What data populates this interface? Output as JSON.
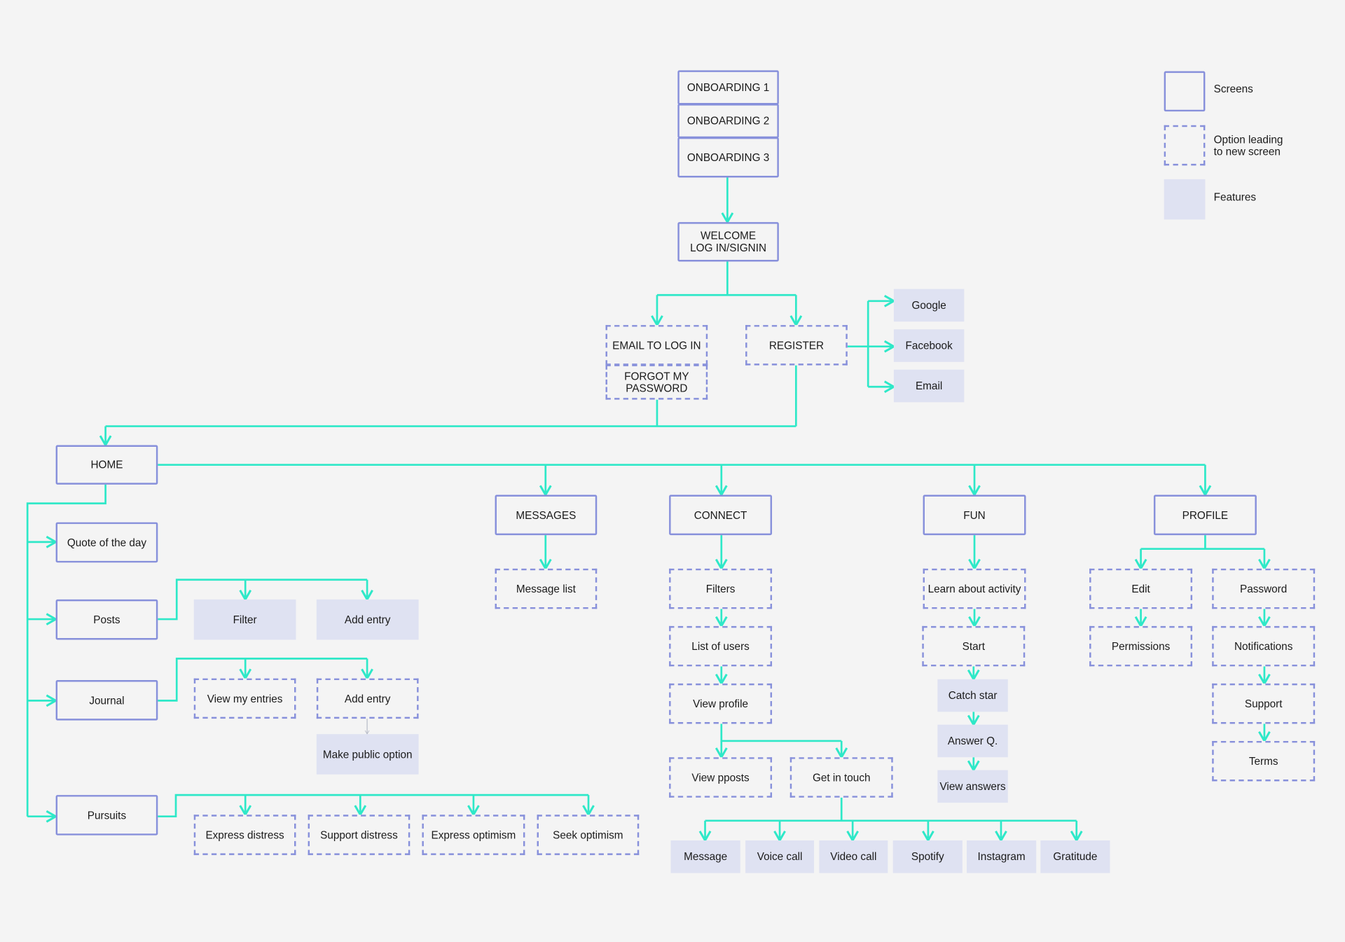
{
  "colors": {
    "background": "#f4f4f4",
    "border": "#8790db",
    "feature_fill": "#dfe2f2",
    "connector": "#2ee8c8"
  },
  "legend": [
    {
      "kind": "screen",
      "label": "Screens"
    },
    {
      "kind": "option",
      "label": "Option leading\nto new screen"
    },
    {
      "kind": "feature",
      "label": "Features"
    }
  ],
  "nodes": [
    {
      "id": "ob1",
      "kind": "screen",
      "label": "ONBOARDING 1"
    },
    {
      "id": "ob2",
      "kind": "screen",
      "label": "ONBOARDING 2"
    },
    {
      "id": "ob3",
      "kind": "screen",
      "label": "ONBOARDING 3"
    },
    {
      "id": "welcome",
      "kind": "screen",
      "label": "WELCOME\nLOG IN/SIGNIN"
    },
    {
      "id": "emaillogin",
      "kind": "option",
      "label": "EMAIL TO LOG IN"
    },
    {
      "id": "forgot",
      "kind": "option",
      "label": "FORGOT MY\nPASSWORD"
    },
    {
      "id": "register",
      "kind": "option",
      "label": "REGISTER"
    },
    {
      "id": "google",
      "kind": "feature",
      "label": "Google"
    },
    {
      "id": "facebook",
      "kind": "feature",
      "label": "Facebook"
    },
    {
      "id": "email",
      "kind": "feature",
      "label": "Email"
    },
    {
      "id": "home",
      "kind": "screen",
      "label": "HOME"
    },
    {
      "id": "messages",
      "kind": "screen",
      "label": "MESSAGES"
    },
    {
      "id": "connect",
      "kind": "screen",
      "label": "CONNECT"
    },
    {
      "id": "fun",
      "kind": "screen",
      "label": "FUN"
    },
    {
      "id": "profile",
      "kind": "screen",
      "label": "PROFILE"
    },
    {
      "id": "quote",
      "kind": "screen",
      "label": "Quote of the day"
    },
    {
      "id": "posts",
      "kind": "screen",
      "label": "Posts"
    },
    {
      "id": "journal",
      "kind": "screen",
      "label": "Journal"
    },
    {
      "id": "pursuits",
      "kind": "screen",
      "label": "Pursuits"
    },
    {
      "id": "filter",
      "kind": "feature",
      "label": "Filter"
    },
    {
      "id": "postadd",
      "kind": "feature",
      "label": "Add entry"
    },
    {
      "id": "viewentries",
      "kind": "option",
      "label": "View my entries"
    },
    {
      "id": "journaladd",
      "kind": "option",
      "label": "Add entry"
    },
    {
      "id": "makepublic",
      "kind": "feature",
      "label": "Make public option"
    },
    {
      "id": "exdistress",
      "kind": "option",
      "label": "Express distress"
    },
    {
      "id": "supdistress",
      "kind": "option",
      "label": "Support distress"
    },
    {
      "id": "exoptimism",
      "kind": "option",
      "label": "Express optimism"
    },
    {
      "id": "seekoptimism",
      "kind": "option",
      "label": "Seek optimism"
    },
    {
      "id": "messagelist",
      "kind": "option",
      "label": "Message list"
    },
    {
      "id": "filters",
      "kind": "option",
      "label": "Filters"
    },
    {
      "id": "listusers",
      "kind": "option",
      "label": "List of users"
    },
    {
      "id": "viewprofile",
      "kind": "option",
      "label": "View profile"
    },
    {
      "id": "viewposts",
      "kind": "option",
      "label": "View pposts"
    },
    {
      "id": "getintouch",
      "kind": "option",
      "label": "Get in touch"
    },
    {
      "id": "cmessage",
      "kind": "feature",
      "label": "Message"
    },
    {
      "id": "voicecall",
      "kind": "feature",
      "label": "Voice call"
    },
    {
      "id": "videocall",
      "kind": "feature",
      "label": "Video call"
    },
    {
      "id": "spotify",
      "kind": "feature",
      "label": "Spotify"
    },
    {
      "id": "instagram",
      "kind": "feature",
      "label": "Instagram"
    },
    {
      "id": "gratitude",
      "kind": "feature",
      "label": "Gratitude"
    },
    {
      "id": "learn",
      "kind": "option",
      "label": "Learn about activity"
    },
    {
      "id": "start",
      "kind": "option",
      "label": "Start"
    },
    {
      "id": "catchstar",
      "kind": "feature",
      "label": "Catch star"
    },
    {
      "id": "answerq",
      "kind": "feature",
      "label": "Answer Q."
    },
    {
      "id": "viewanswers",
      "kind": "feature",
      "label": "View answers"
    },
    {
      "id": "edit",
      "kind": "option",
      "label": "Edit"
    },
    {
      "id": "password",
      "kind": "option",
      "label": "Password"
    },
    {
      "id": "permissions",
      "kind": "option",
      "label": "Permissions"
    },
    {
      "id": "notifications",
      "kind": "option",
      "label": "Notifications"
    },
    {
      "id": "support",
      "kind": "option",
      "label": "Support"
    },
    {
      "id": "terms",
      "kind": "option",
      "label": "Terms"
    }
  ]
}
